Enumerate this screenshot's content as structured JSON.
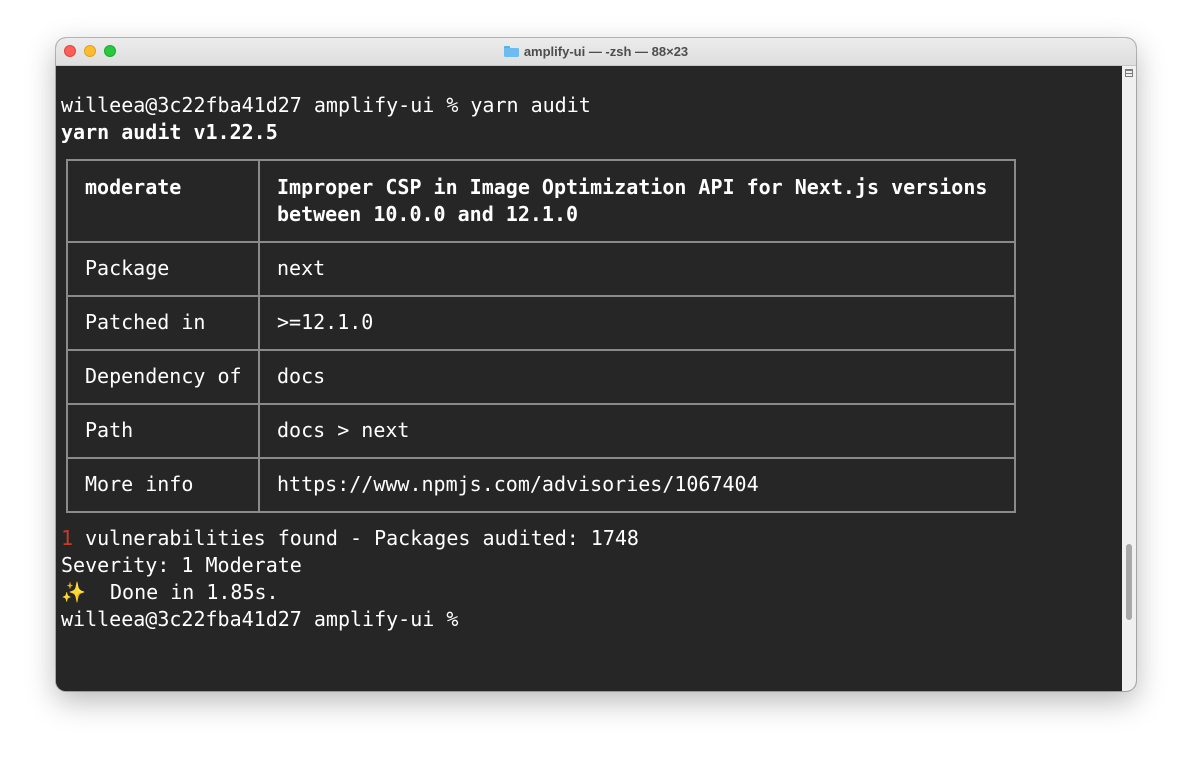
{
  "window": {
    "title": "amplify-ui — -zsh — 88×23"
  },
  "terminal": {
    "prompt_command": "willeea@3c22fba41d27 amplify-ui % yarn audit",
    "yarn_version": "yarn audit v1.22.5",
    "advisory": {
      "severity": "moderate",
      "title_line1": "Improper CSP in Image Optimization API for Next.js versions",
      "title_line2": "between 10.0.0 and 12.1.0",
      "rows": [
        {
          "label": "Package",
          "value": "next"
        },
        {
          "label": "Patched in",
          "value": ">=12.1.0"
        },
        {
          "label": "Dependency of",
          "value": "docs"
        },
        {
          "label": "Path",
          "value": "docs > next"
        },
        {
          "label": "More info",
          "value": "https://www.npmjs.com/advisories/1067404"
        }
      ]
    },
    "summary_count": "1",
    "summary_text": " vulnerabilities found - Packages audited: 1748",
    "severity_line": "Severity: 1 Moderate",
    "sparkle_glyph": "✨",
    "done_text": "  Done in 1.85s.",
    "final_prompt": "willeea@3c22fba41d27 amplify-ui %"
  },
  "colors": {
    "terminal_bg": "#262626",
    "moderate": "#b8b83a",
    "count_red": "#c73b2b",
    "table_border": "#8a8a8a"
  }
}
